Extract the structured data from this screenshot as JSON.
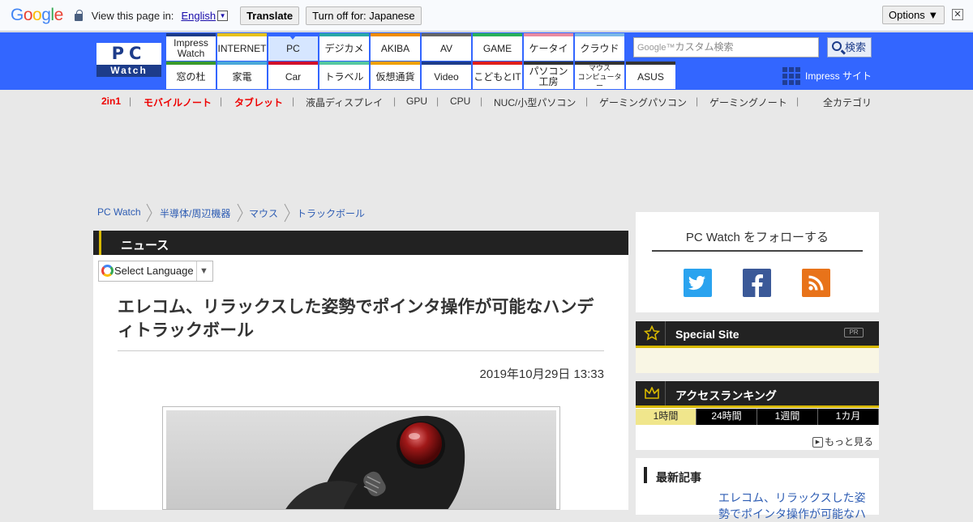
{
  "translate_bar": {
    "logo_letters": [
      "G",
      "o",
      "o",
      "g",
      "l",
      "e"
    ],
    "logo_colors": [
      "#4285f4",
      "#ea4335",
      "#fbbc05",
      "#4285f4",
      "#34a853",
      "#ea4335"
    ],
    "view_in": "View this page in:",
    "language": "English",
    "translate_label": "Translate",
    "turn_off_label": "Turn off for: Japanese",
    "options_label": "Options ▼",
    "close_label": "✕"
  },
  "header": {
    "logo_pc": "PC",
    "logo_watch": "Watch",
    "nav_top": [
      {
        "label": "Impress\nWatch",
        "color": "#1d3c8a"
      },
      {
        "label": "INTERNET",
        "color": "#e6c11a"
      },
      {
        "label": "PC",
        "color": "#3366ff",
        "active": true
      },
      {
        "label": "デジカメ",
        "color": "#2aa7a7"
      },
      {
        "label": "AKIBA",
        "color": "#f08c00"
      },
      {
        "label": "AV",
        "color": "#666666"
      },
      {
        "label": "GAME",
        "color": "#2ab05a"
      },
      {
        "label": "ケータイ",
        "color": "#e88aa0"
      },
      {
        "label": "クラウド",
        "color": "#7ab8e8"
      }
    ],
    "nav_bottom": [
      {
        "label": "窓の杜",
        "color": "#3a9a2a"
      },
      {
        "label": "家電",
        "color": "#4aa8d8"
      },
      {
        "label": "Car",
        "color": "#d0102a"
      },
      {
        "label": "トラベル",
        "color": "#55c8a0"
      },
      {
        "label": "仮想通貨",
        "color": "#f0a000"
      },
      {
        "label": "Video",
        "color": "#1d3c8a"
      },
      {
        "label": "こどもとIT",
        "color": "#e0201a"
      },
      {
        "label": "パソコン\n工房",
        "color": "#333333"
      },
      {
        "label": "マウス\nコンピューター",
        "color": "#333333"
      },
      {
        "label": "ASUS",
        "color": "#333333"
      }
    ],
    "search_google": "Google™",
    "search_placeholder": "カスタム検索",
    "search_button": "検索",
    "impress_site": "Impress サイト"
  },
  "subnav": {
    "items": [
      "2in1",
      "モバイルノート",
      "タブレット",
      "液晶ディスプレイ",
      "GPU",
      "CPU",
      "NUC/小型パソコン",
      "ゲーミングパソコン",
      "ゲーミングノート"
    ],
    "separator": "|",
    "all_categories": "全カテゴリ"
  },
  "breadcrumb": [
    "PC Watch",
    "半導体/周辺機器",
    "マウス",
    "トラックボール"
  ],
  "article": {
    "section": "ニュース",
    "select_language": "Select Language",
    "select_arrow": "▼",
    "title": "エレコム、リラックスした姿勢でポインタ操作が可能なハンディトラックボール",
    "date": "2019年10月29日 13:33"
  },
  "sidebar": {
    "follow_title": "PC Watch をフォローする",
    "social": [
      {
        "name": "twitter-icon",
        "color": "#2aa3ef"
      },
      {
        "name": "facebook-icon",
        "color": "#3b5998"
      },
      {
        "name": "rss-icon",
        "color": "#e8731a"
      }
    ],
    "special_site": "Special Site",
    "pr": "PR",
    "ranking_title": "アクセスランキング",
    "ranking_tabs": [
      "1時間",
      "24時間",
      "1週間",
      "1カ月"
    ],
    "more": "もっと見る",
    "latest_title": "最新記事",
    "latest_article": "エレコム、リラックスした姿勢でポインタ操作が可能なハ"
  }
}
